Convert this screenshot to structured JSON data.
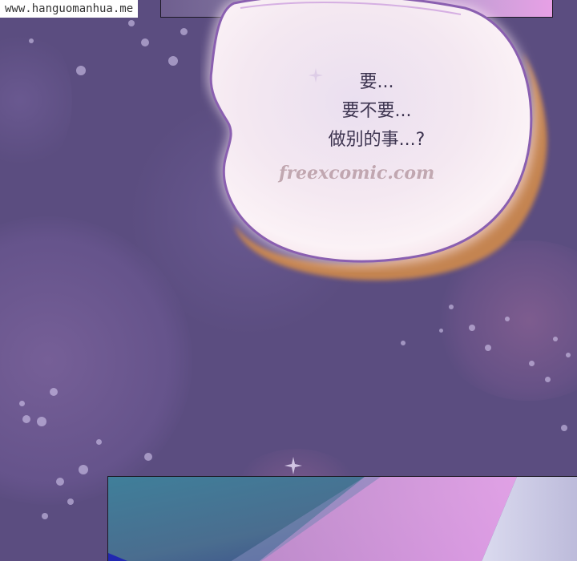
{
  "watermark_top": "www.hanguomanhua.me",
  "speech_bubble": {
    "lines": [
      "要...",
      "要不要...",
      "做别的事...?"
    ]
  },
  "site_watermark": "freexcomic.com",
  "colors": {
    "background": "#5b4d80",
    "bubble_fill": "#f3e6f0",
    "bubble_outline": "#8a5fb0",
    "bubble_shadow": "#d08a4c"
  }
}
